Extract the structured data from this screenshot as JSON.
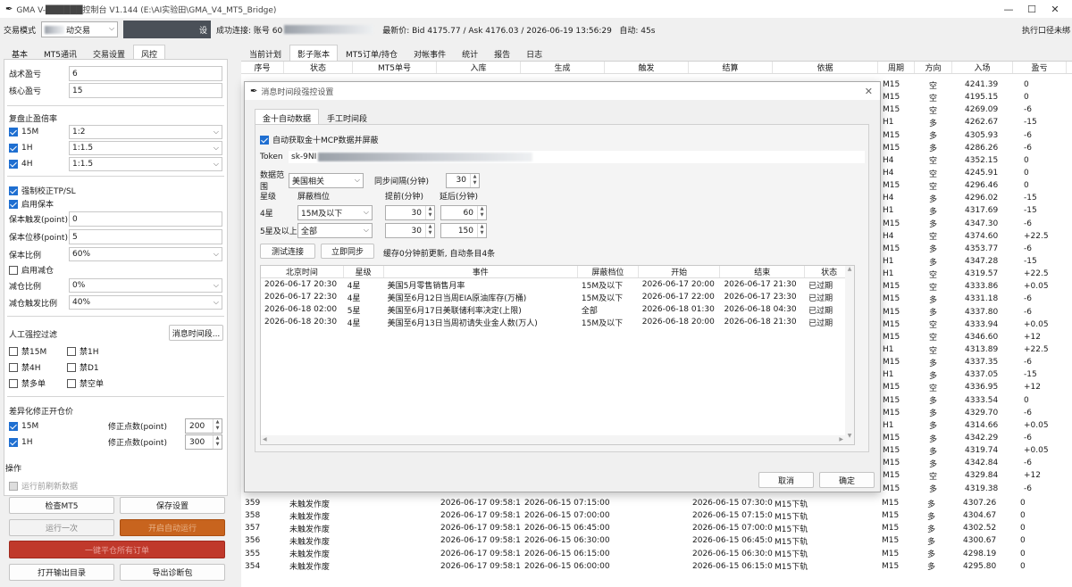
{
  "window": {
    "title": "GMA V-██████控制台 V1.144  (E:\\AI实验田\\GMA_V4_MT5_Bridge)",
    "controls": [
      "—",
      "☐",
      "✕"
    ]
  },
  "toolbar": {
    "mode_label": "交易模式",
    "mode_value": "动交易",
    "account_btn_suffix": "设",
    "status": "成功连接: 账号 60",
    "quote": "最新价: Bid 4175.77 / Ask 4176.03 / 2026-06-19 13:56:29   自动: 45s",
    "right_status": "执行口径未绑"
  },
  "left": {
    "tabs": [
      "基本",
      "MT5通讯",
      "交易设置",
      "风控"
    ],
    "tactical_label": "战术盈亏",
    "tactical_value": "6",
    "core_label": "核心盈亏",
    "core_value": "15",
    "ratio_title": "复盘止盈倍率",
    "ratios": [
      {
        "label": "15M",
        "value": "1:2"
      },
      {
        "label": "1H",
        "value": "1:1.5"
      },
      {
        "label": "4H",
        "value": "1:1.5"
      }
    ],
    "force_tp": "强制校正TP/SL",
    "enable_protect": "启用保本",
    "protect_trigger_label": "保本触发(point)",
    "protect_trigger_value": "0",
    "protect_offset_label": "保本位移(point)",
    "protect_offset_value": "5",
    "protect_ratio_label": "保本比例",
    "protect_ratio_value": "60%",
    "enable_reduce": "启用减仓",
    "reduce_ratio_label": "减仓比例",
    "reduce_ratio_value": "0%",
    "reduce_trigger_label": "减仓触发比例",
    "reduce_trigger_value": "40%",
    "manual_filter_title": "人工强控过滤",
    "news_btn": "消息时间段...",
    "filters": [
      "禁15M",
      "禁1H",
      "禁4H",
      "禁D1",
      "禁多单",
      "禁空单"
    ],
    "diff_title": "差异化修正开仓价",
    "diff_rows": [
      {
        "label": "15M",
        "fix_label": "修正点数(point)",
        "value": "200"
      },
      {
        "label": "1H",
        "fix_label": "修正点数(point)",
        "value": "300"
      }
    ],
    "ops_title": "操作",
    "refresh_before_run": "运行前刷新数据",
    "btn_check_mt5": "检查MT5",
    "btn_save": "保存设置",
    "btn_run_once": "运行一次",
    "btn_auto": "开启自动运行",
    "btn_close_all": "一键平仓所有订单",
    "btn_open_dir": "打开输出目录",
    "btn_export": "导出诊断包",
    "colors": {
      "accent": "#1f6fd1",
      "orange": "#c8641e",
      "red": "#c0392b"
    }
  },
  "main": {
    "tabs": [
      "当前计划",
      "影子账本",
      "MT5订单/持仓",
      "对帐事件",
      "统计",
      "报告",
      "日志"
    ],
    "columns": [
      "序号",
      "状态",
      "MT5单号",
      "入库",
      "生成",
      "触发",
      "结算",
      "依据",
      "周期",
      "方向",
      "入场",
      "盈亏"
    ],
    "right_rows": [
      [
        "M15",
        "空",
        "4241.39",
        "0"
      ],
      [
        "M15",
        "空",
        "4195.15",
        "0"
      ],
      [
        "M15",
        "空",
        "4269.09",
        "-6"
      ],
      [
        "H1",
        "多",
        "4262.67",
        "-15"
      ],
      [
        "M15",
        "多",
        "4305.93",
        "-6"
      ],
      [
        "M15",
        "多",
        "4286.26",
        "-6"
      ],
      [
        "H4",
        "空",
        "4352.15",
        "0"
      ],
      [
        "H4",
        "空",
        "4245.91",
        "0"
      ],
      [
        "M15",
        "空",
        "4296.46",
        "0"
      ],
      [
        "H4",
        "多",
        "4296.02",
        "-15"
      ],
      [
        "H1",
        "多",
        "4317.69",
        "-15"
      ],
      [
        "M15",
        "多",
        "4347.30",
        "-6"
      ],
      [
        "H4",
        "空",
        "4374.60",
        "+22.5"
      ],
      [
        "M15",
        "多",
        "4353.77",
        "-6"
      ],
      [
        "H1",
        "多",
        "4347.28",
        "-15"
      ],
      [
        "H1",
        "空",
        "4319.57",
        "+22.5"
      ],
      [
        "M15",
        "空",
        "4333.86",
        "+0.05"
      ],
      [
        "M15",
        "多",
        "4331.18",
        "-6"
      ],
      [
        "M15",
        "多",
        "4337.80",
        "-6"
      ],
      [
        "M15",
        "空",
        "4333.94",
        "+0.05"
      ],
      [
        "M15",
        "空",
        "4346.60",
        "+12"
      ],
      [
        "H1",
        "空",
        "4313.89",
        "+22.5"
      ],
      [
        "M15",
        "多",
        "4337.35",
        "-6"
      ],
      [
        "H1",
        "多",
        "4337.05",
        "-15"
      ],
      [
        "M15",
        "空",
        "4336.95",
        "+12"
      ],
      [
        "M15",
        "多",
        "4333.54",
        "0"
      ],
      [
        "M15",
        "多",
        "4329.70",
        "-6"
      ],
      [
        "H1",
        "多",
        "4314.66",
        "+0.05"
      ],
      [
        "M15",
        "多",
        "4342.29",
        "-6"
      ],
      [
        "M15",
        "多",
        "4319.74",
        "+0.05"
      ],
      [
        "M15",
        "多",
        "4342.84",
        "-6"
      ],
      [
        "M15",
        "空",
        "4329.84",
        "+12"
      ],
      [
        "M15",
        "多",
        "4319.38",
        "-6"
      ]
    ],
    "bottom_rows": [
      {
        "seq": "359",
        "status": "未触发作废",
        "stored": "2026-06-17 09:58:19",
        "gen": "2026-06-15 07:15:00",
        "settle": "2026-06-15 07:30:00",
        "basis": "M15下轨",
        "period": "M15",
        "dir": "多",
        "entry": "4307.26",
        "pnl": "0"
      },
      {
        "seq": "358",
        "status": "未触发作废",
        "stored": "2026-06-17 09:58:19",
        "gen": "2026-06-15 07:00:00",
        "settle": "2026-06-15 07:15:00",
        "basis": "M15下轨",
        "period": "M15",
        "dir": "多",
        "entry": "4304.67",
        "pnl": "0"
      },
      {
        "seq": "357",
        "status": "未触发作废",
        "stored": "2026-06-17 09:58:19",
        "gen": "2026-06-15 06:45:00",
        "settle": "2026-06-15 07:00:00",
        "basis": "M15下轨",
        "period": "M15",
        "dir": "多",
        "entry": "4302.52",
        "pnl": "0"
      },
      {
        "seq": "356",
        "status": "未触发作废",
        "stored": "2026-06-17 09:58:19",
        "gen": "2026-06-15 06:30:00",
        "settle": "2026-06-15 06:45:00",
        "basis": "M15下轨",
        "period": "M15",
        "dir": "多",
        "entry": "4300.67",
        "pnl": "0"
      },
      {
        "seq": "355",
        "status": "未触发作废",
        "stored": "2026-06-17 09:58:19",
        "gen": "2026-06-15 06:15:00",
        "settle": "2026-06-15 06:30:00",
        "basis": "M15下轨",
        "period": "M15",
        "dir": "多",
        "entry": "4298.19",
        "pnl": "0"
      },
      {
        "seq": "354",
        "status": "未触发作废",
        "stored": "2026-06-17 09:58:19",
        "gen": "2026-06-15 06:00:00",
        "settle": "2026-06-15 06:15:00",
        "basis": "M15下轨",
        "period": "M15",
        "dir": "多",
        "entry": "4295.80",
        "pnl": "0"
      }
    ]
  },
  "dialog": {
    "title": "消息时间段强控设置",
    "tabs": [
      "金十自动数据",
      "手工时间段"
    ],
    "auto_fetch": "自动获取金十MCP数据并屏蔽",
    "token_label": "Token",
    "token_value": "sk-9NI",
    "range_label": "数据范围",
    "range_value": "美国相关",
    "sync_label": "同步间隔(分钟)",
    "sync_value": "30",
    "star_hdr": "星级",
    "level_hdr": "屏蔽档位",
    "before_hdr": "提前(分钟)",
    "after_hdr": "延后(分钟)",
    "star_rows": [
      {
        "star": "4星",
        "level": "15M及以下",
        "before": "30",
        "after": "60"
      },
      {
        "star": "5星及以上",
        "level": "全部",
        "before": "30",
        "after": "150"
      }
    ],
    "btn_test": "测试连接",
    "btn_sync": "立即同步",
    "cache_status": "缓存0分钟前更新, 自动条目4条",
    "columns": [
      "北京时间",
      "星级",
      "事件",
      "屏蔽档位",
      "开始",
      "结束",
      "状态"
    ],
    "events": [
      {
        "time": "2026-06-17 20:30",
        "star": "4星",
        "event": "美国5月零售销售月率",
        "level": "15M及以下",
        "start": "2026-06-17 20:00",
        "end": "2026-06-17 21:30",
        "status": "已过期"
      },
      {
        "time": "2026-06-17 22:30",
        "star": "4星",
        "event": "美国至6月12日当周EIA原油库存(万桶)",
        "level": "15M及以下",
        "start": "2026-06-17 22:00",
        "end": "2026-06-17 23:30",
        "status": "已过期"
      },
      {
        "time": "2026-06-18 02:00",
        "star": "5星",
        "event": "美国至6月17日美联储利率决定(上限)",
        "level": "全部",
        "start": "2026-06-18 01:30",
        "end": "2026-06-18 04:30",
        "status": "已过期"
      },
      {
        "time": "2026-06-18 20:30",
        "star": "4星",
        "event": "美国至6月13日当周初请失业金人数(万人)",
        "level": "15M及以下",
        "start": "2026-06-18 20:00",
        "end": "2026-06-18 21:30",
        "status": "已过期"
      }
    ],
    "btn_cancel": "取消",
    "btn_ok": "确定"
  }
}
